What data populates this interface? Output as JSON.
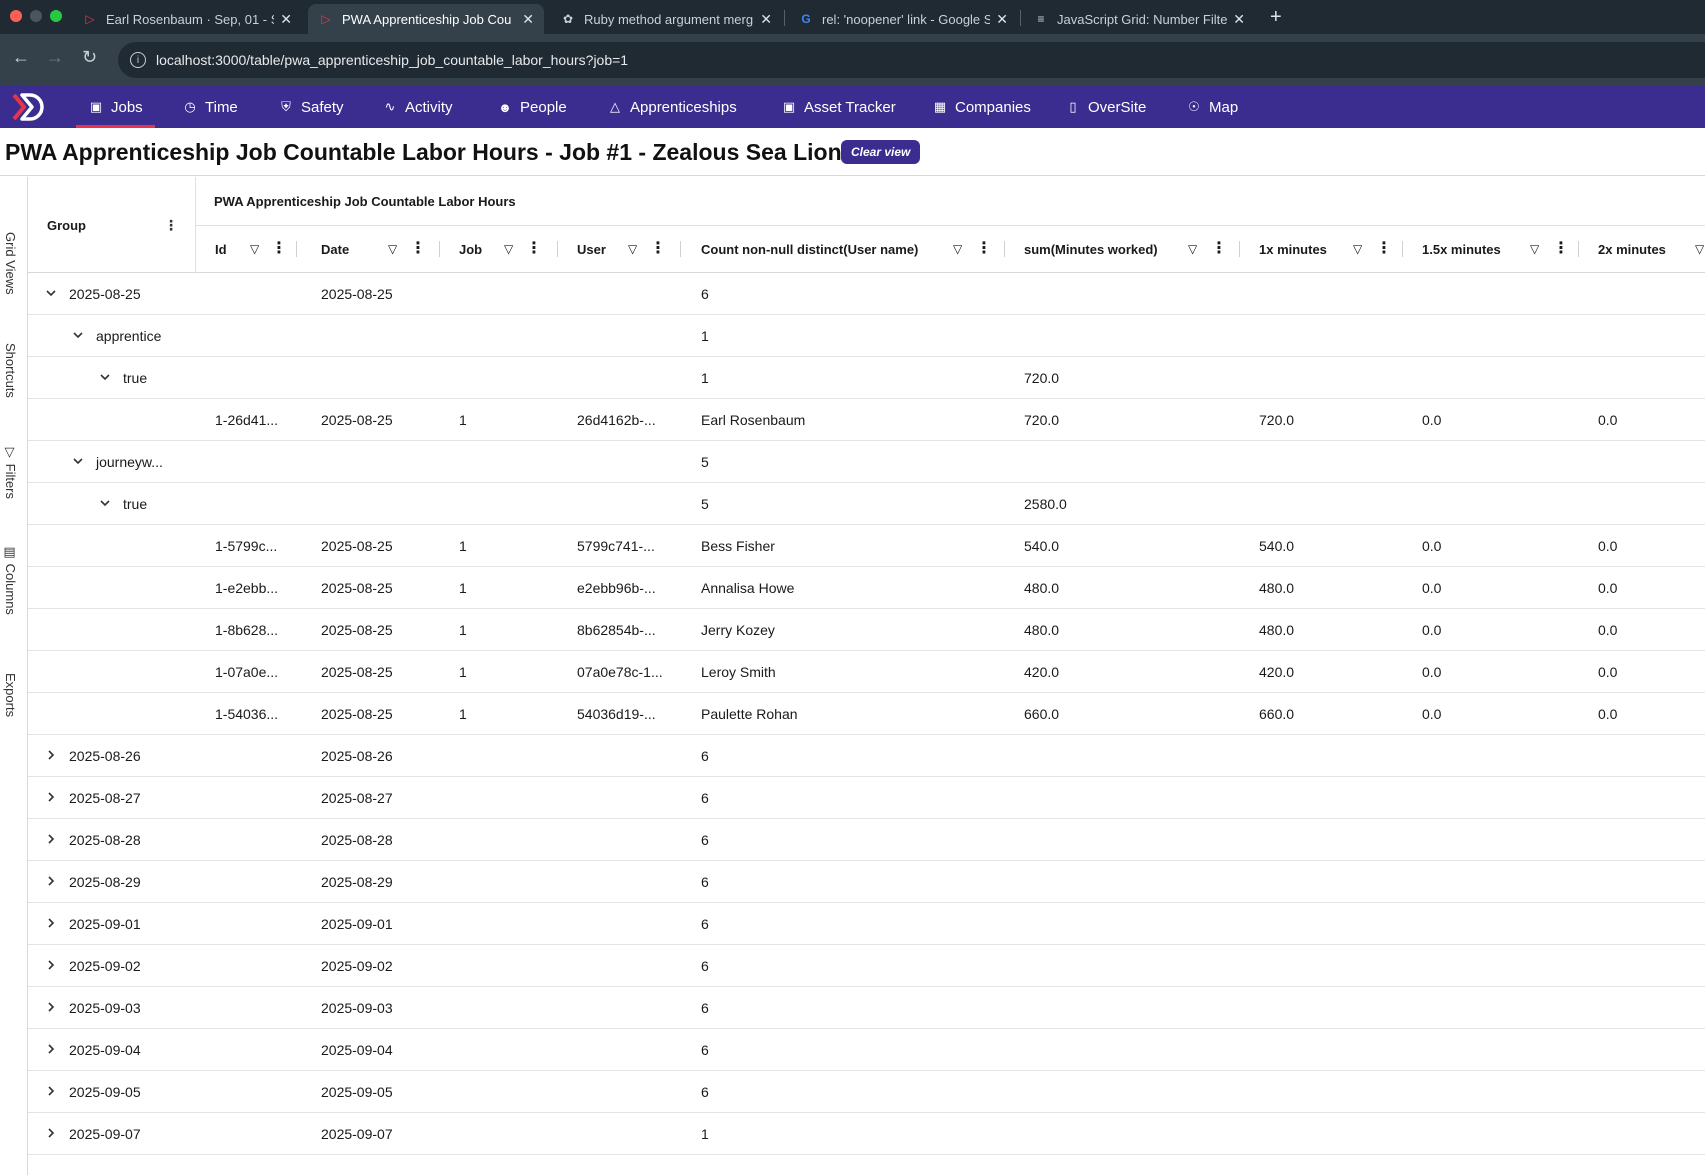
{
  "browser": {
    "tabs": [
      {
        "title": "Earl Rosenbaum · Sep, 01 - S",
        "active": false,
        "favicon": "logo-icon"
      },
      {
        "title": "PWA Apprenticeship Job Cou",
        "active": true,
        "favicon": "logo-icon"
      },
      {
        "title": "Ruby method argument merg",
        "active": false,
        "favicon": "openai-icon"
      },
      {
        "title": "rel: 'noopener' link - Google S",
        "active": false,
        "favicon": "google-icon"
      },
      {
        "title": "JavaScript Grid: Number Filte",
        "active": false,
        "favicon": "aggrid-icon"
      }
    ],
    "url": "localhost:3000/table/pwa_apprenticeship_job_countable_labor_hours?job=1"
  },
  "nav": {
    "items": [
      {
        "label": "Jobs",
        "icon": "briefcase-icon",
        "active": true
      },
      {
        "label": "Time",
        "icon": "clock-icon",
        "active": false
      },
      {
        "label": "Safety",
        "icon": "shield-icon",
        "active": false
      },
      {
        "label": "Activity",
        "icon": "activity-icon",
        "active": false
      },
      {
        "label": "People",
        "icon": "people-icon",
        "active": false
      },
      {
        "label": "Apprenticeships",
        "icon": "graduation-cap-icon",
        "active": false
      },
      {
        "label": "Asset Tracker",
        "icon": "camera-icon",
        "active": false
      },
      {
        "label": "Companies",
        "icon": "building-icon",
        "active": false
      },
      {
        "label": "OverSite",
        "icon": "map-book-icon",
        "active": false
      },
      {
        "label": "Map",
        "icon": "globe-icon",
        "active": false
      }
    ],
    "accent": "#3b2d8f",
    "active_underline": "#e8334a"
  },
  "page": {
    "title": "PWA Apprenticeship Job Countable Labor Hours - Job #1 - Zealous Sea Lion",
    "clear_view_label": "Clear view"
  },
  "siderail": [
    "Grid Views",
    "Shortcuts",
    "Filters",
    "Columns",
    "Exports"
  ],
  "grid": {
    "group_column_label": "Group",
    "group_header": "PWA Apprenticeship Job Countable Labor Hours",
    "columns": [
      "Id",
      "Date",
      "Job",
      "User",
      "Count non-null distinct(User name)",
      "sum(Minutes worked)",
      "1x minutes",
      "1.5x minutes",
      "2x minutes"
    ],
    "rows": [
      {
        "level": 0,
        "chevron": "down",
        "group": "2025-08-25",
        "cells": [
          "",
          "2025-08-25",
          "",
          "",
          "6",
          "",
          "",
          "",
          ""
        ]
      },
      {
        "level": 1,
        "chevron": "down",
        "group": "apprentice",
        "cells": [
          "",
          "",
          "",
          "",
          "1",
          "",
          "",
          "",
          ""
        ]
      },
      {
        "level": 2,
        "chevron": "down",
        "group": "true",
        "cells": [
          "",
          "",
          "",
          "",
          "1",
          "720.0",
          "",
          "",
          ""
        ]
      },
      {
        "level": 3,
        "chevron": "",
        "group": "",
        "cells": [
          "1-26d41...",
          "2025-08-25",
          "1",
          "26d4162b-...",
          "Earl Rosenbaum",
          "720.0",
          "720.0",
          "0.0",
          "0.0"
        ]
      },
      {
        "level": 1,
        "chevron": "down",
        "group": "journeyw...",
        "cells": [
          "",
          "",
          "",
          "",
          "5",
          "",
          "",
          "",
          ""
        ]
      },
      {
        "level": 2,
        "chevron": "down",
        "group": "true",
        "cells": [
          "",
          "",
          "",
          "",
          "5",
          "2580.0",
          "",
          "",
          ""
        ]
      },
      {
        "level": 3,
        "chevron": "",
        "group": "",
        "cells": [
          "1-5799c...",
          "2025-08-25",
          "1",
          "5799c741-...",
          "Bess Fisher",
          "540.0",
          "540.0",
          "0.0",
          "0.0"
        ]
      },
      {
        "level": 3,
        "chevron": "",
        "group": "",
        "cells": [
          "1-e2ebb...",
          "2025-08-25",
          "1",
          "e2ebb96b-...",
          "Annalisa Howe",
          "480.0",
          "480.0",
          "0.0",
          "0.0"
        ]
      },
      {
        "level": 3,
        "chevron": "",
        "group": "",
        "cells": [
          "1-8b628...",
          "2025-08-25",
          "1",
          "8b62854b-...",
          "Jerry Kozey",
          "480.0",
          "480.0",
          "0.0",
          "0.0"
        ]
      },
      {
        "level": 3,
        "chevron": "",
        "group": "",
        "cells": [
          "1-07a0e...",
          "2025-08-25",
          "1",
          "07a0e78c-1...",
          "Leroy Smith",
          "420.0",
          "420.0",
          "0.0",
          "0.0"
        ]
      },
      {
        "level": 3,
        "chevron": "",
        "group": "",
        "cells": [
          "1-54036...",
          "2025-08-25",
          "1",
          "54036d19-...",
          "Paulette Rohan",
          "660.0",
          "660.0",
          "0.0",
          "0.0"
        ]
      },
      {
        "level": 0,
        "chevron": "right",
        "group": "2025-08-26",
        "cells": [
          "",
          "2025-08-26",
          "",
          "",
          "6",
          "",
          "",
          "",
          ""
        ]
      },
      {
        "level": 0,
        "chevron": "right",
        "group": "2025-08-27",
        "cells": [
          "",
          "2025-08-27",
          "",
          "",
          "6",
          "",
          "",
          "",
          ""
        ]
      },
      {
        "level": 0,
        "chevron": "right",
        "group": "2025-08-28",
        "cells": [
          "",
          "2025-08-28",
          "",
          "",
          "6",
          "",
          "",
          "",
          ""
        ]
      },
      {
        "level": 0,
        "chevron": "right",
        "group": "2025-08-29",
        "cells": [
          "",
          "2025-08-29",
          "",
          "",
          "6",
          "",
          "",
          "",
          ""
        ]
      },
      {
        "level": 0,
        "chevron": "right",
        "group": "2025-09-01",
        "cells": [
          "",
          "2025-09-01",
          "",
          "",
          "6",
          "",
          "",
          "",
          ""
        ]
      },
      {
        "level": 0,
        "chevron": "right",
        "group": "2025-09-02",
        "cells": [
          "",
          "2025-09-02",
          "",
          "",
          "6",
          "",
          "",
          "",
          ""
        ]
      },
      {
        "level": 0,
        "chevron": "right",
        "group": "2025-09-03",
        "cells": [
          "",
          "2025-09-03",
          "",
          "",
          "6",
          "",
          "",
          "",
          ""
        ]
      },
      {
        "level": 0,
        "chevron": "right",
        "group": "2025-09-04",
        "cells": [
          "",
          "2025-09-04",
          "",
          "",
          "6",
          "",
          "",
          "",
          ""
        ]
      },
      {
        "level": 0,
        "chevron": "right",
        "group": "2025-09-05",
        "cells": [
          "",
          "2025-09-05",
          "",
          "",
          "6",
          "",
          "",
          "",
          ""
        ]
      },
      {
        "level": 0,
        "chevron": "right",
        "group": "2025-09-07",
        "cells": [
          "",
          "2025-09-07",
          "",
          "",
          "1",
          "",
          "",
          "",
          ""
        ]
      }
    ]
  }
}
